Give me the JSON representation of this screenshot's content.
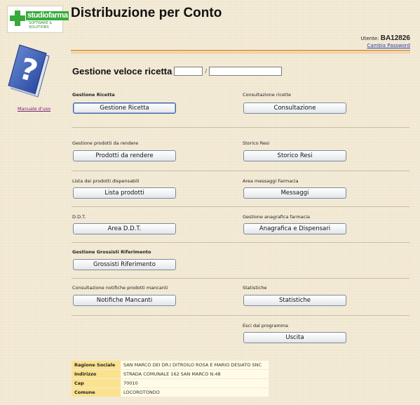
{
  "logo": {
    "brand": "studiofarma",
    "tagline": "SOFTWARE & SOLUTIONS"
  },
  "header": {
    "title": "Distribuzione per Conto",
    "user_label": "Utente:",
    "user_id": "BA12826",
    "change_password": "Cambia Password"
  },
  "sidebar": {
    "manual_link": "Manuale d'uso"
  },
  "quick_search": {
    "label": "Gestione veloce ricetta",
    "separator": "/",
    "field1_value": "",
    "field2_value": ""
  },
  "sections": {
    "gestione_ricetta": {
      "caption": "Gestione Ricetta",
      "button": "Gestione Ricetta"
    },
    "consultazione": {
      "caption": "Consultazione ricette",
      "button": "Consultazione"
    },
    "prodotti_da_rendere": {
      "caption": "Gestione prodotti da rendere",
      "button": "Prodotti da rendere"
    },
    "storico_resi": {
      "caption": "Storico Resi",
      "button": "Storico Resi"
    },
    "lista_prodotti": {
      "caption": "Lista dei prodotti dispensabili",
      "button": "Lista prodotti"
    },
    "messaggi": {
      "caption": "Area messaggi Farmacia",
      "button": "Messaggi"
    },
    "ddt": {
      "caption": "D.D.T.",
      "button": "Area D.D.T."
    },
    "anagrafica": {
      "caption": "Gestione anagrafica farmacia",
      "button": "Anagrafica e Dispensari"
    },
    "grossisti": {
      "caption": "Gestione Grossisti Riferimento",
      "button": "Grossisti Riferimento"
    },
    "notifiche": {
      "caption": "Consultazione notifiche prodotti mancanti",
      "button": "Notifiche Mancanti"
    },
    "statistiche": {
      "caption": "Statistiche",
      "button": "Statistiche"
    },
    "uscita": {
      "caption": "Esci dal programma",
      "button": "Uscita"
    }
  },
  "pharmacy": {
    "rows": [
      {
        "label": "Ragione Sociale",
        "value": "SAN MARCO DEI DR.I DITROILO ROSA E MARIO DESIATO SNC"
      },
      {
        "label": "Indirizzo",
        "value": "STRADA COMUNALE 162 SAN MARCO N.48"
      },
      {
        "label": "Cap",
        "value": "70010"
      },
      {
        "label": "Comune",
        "value": "LOCOROTONDO"
      }
    ]
  },
  "colors": {
    "accent_rule": "#e0a050",
    "table_key_bg": "#fbe28f",
    "logo_green": "#38a93b"
  }
}
